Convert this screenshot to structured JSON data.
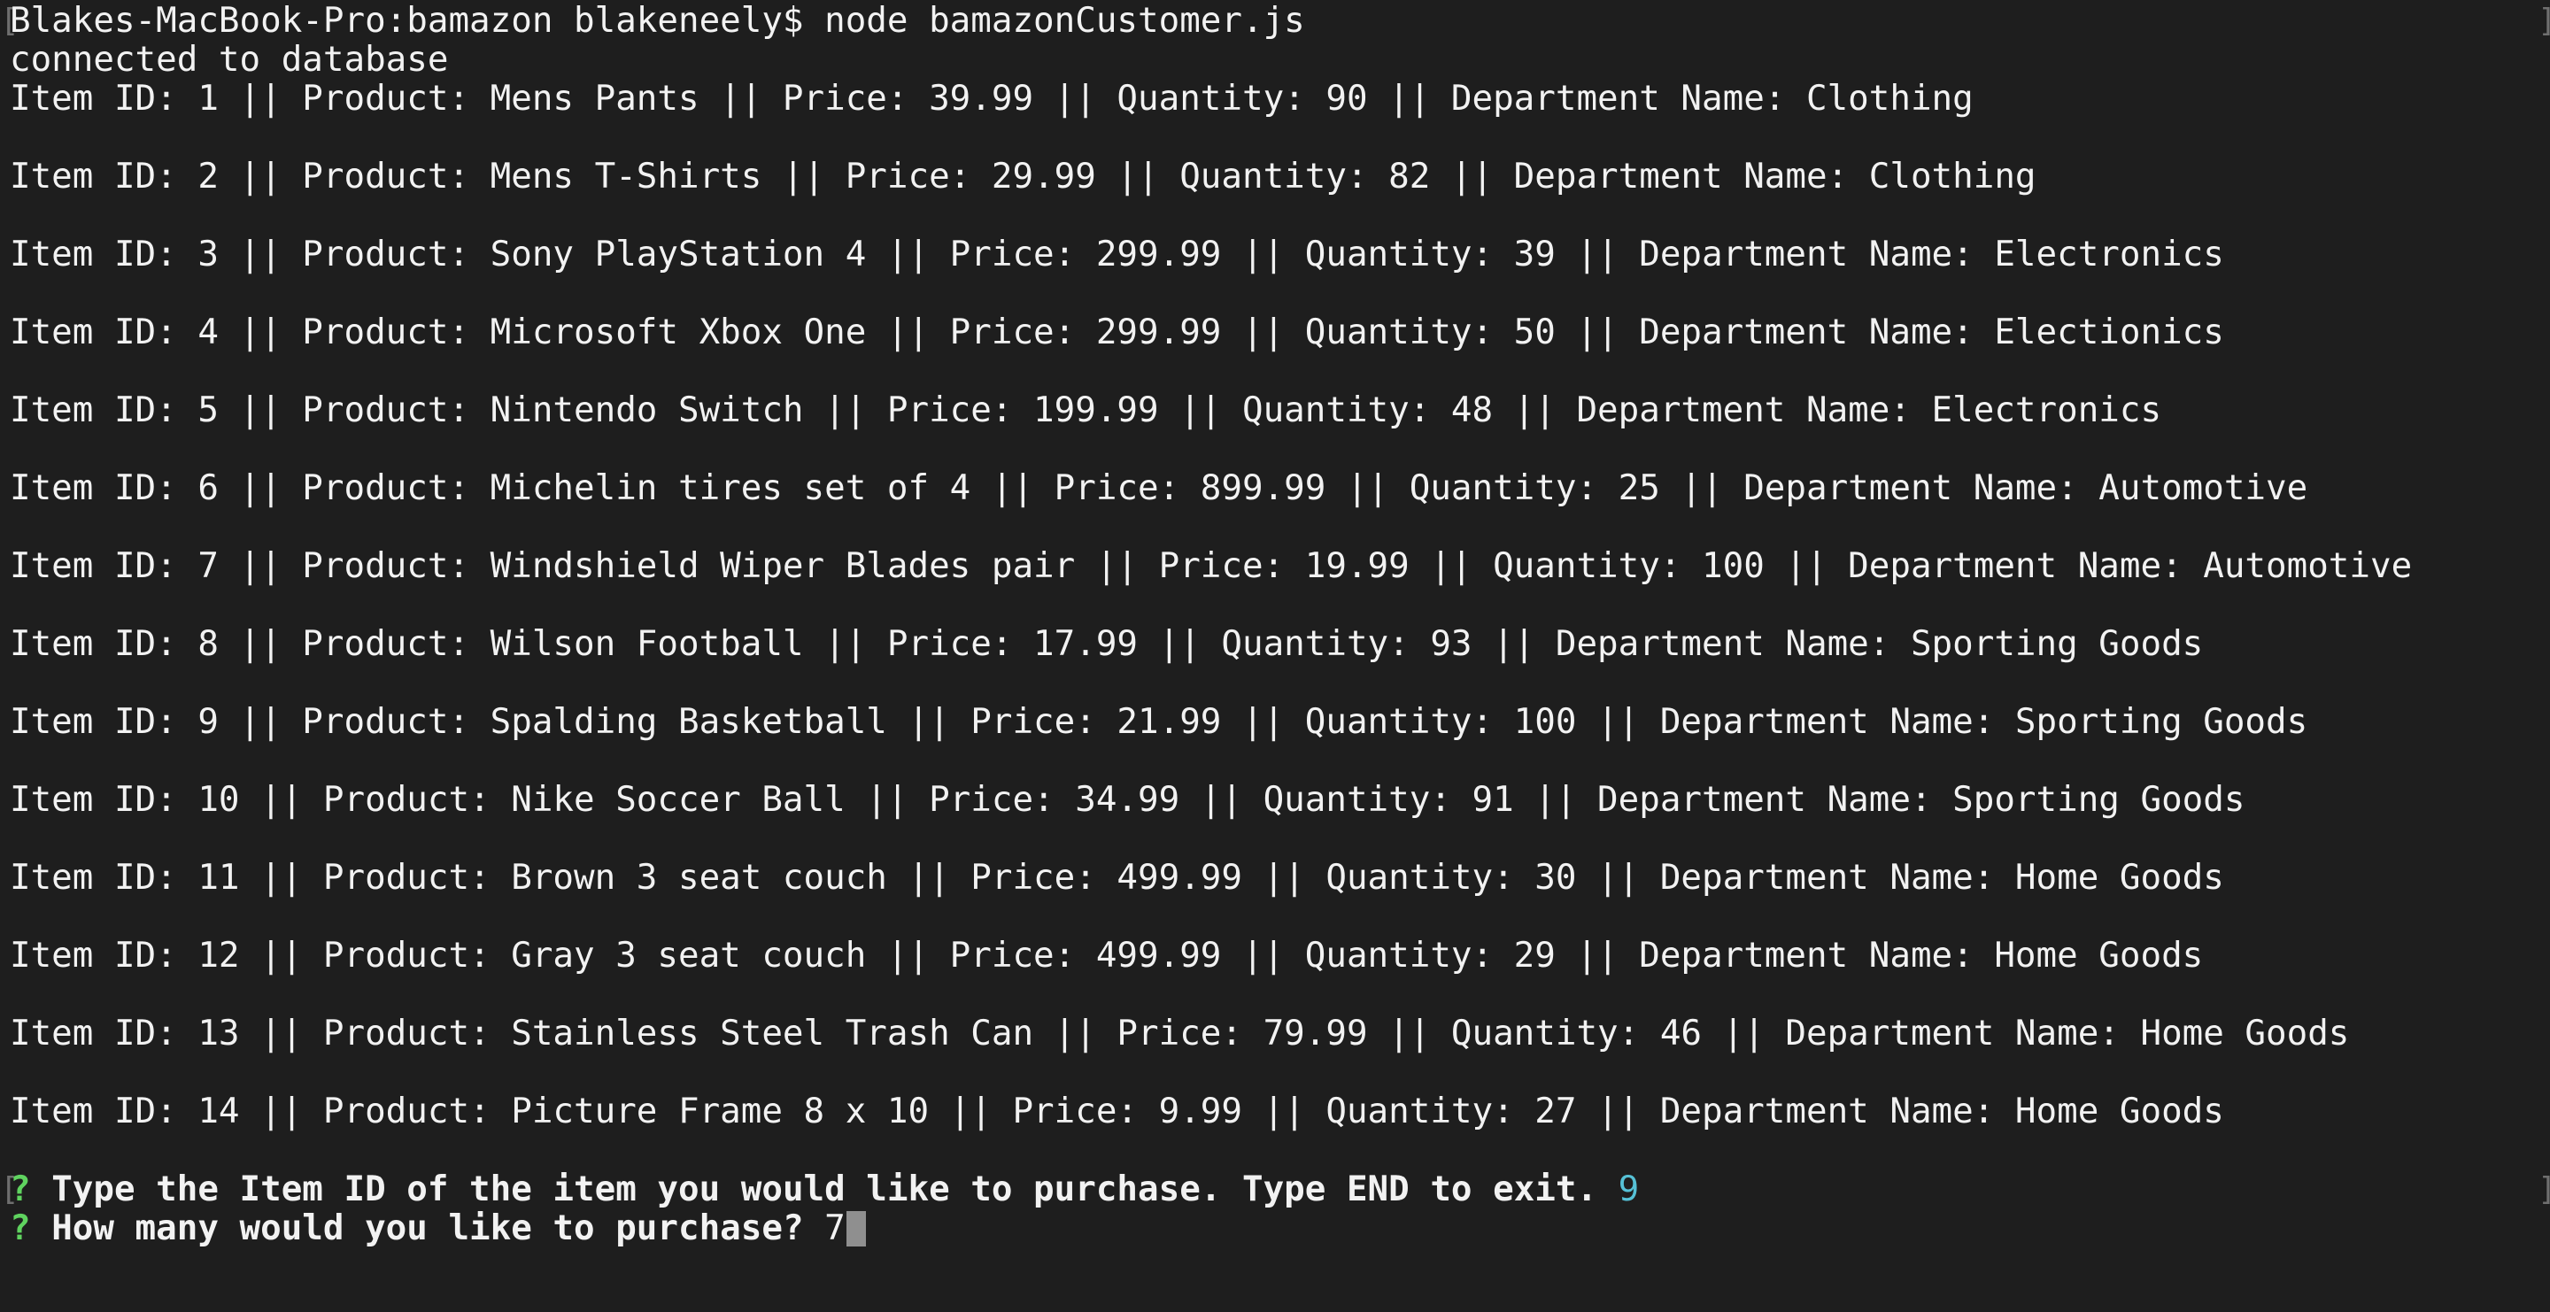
{
  "terminal": {
    "command_line": "Blakes-MacBook-Pro:bamazon blakeneely$ node bamazonCustomer.js",
    "status": "connected to database",
    "items": [
      "Item ID: 1 || Product: Mens Pants || Price: 39.99 || Quantity: 90 || Department Name: Clothing",
      "Item ID: 2 || Product: Mens T-Shirts || Price: 29.99 || Quantity: 82 || Department Name: Clothing",
      "Item ID: 3 || Product: Sony PlayStation 4 || Price: 299.99 || Quantity: 39 || Department Name: Electronics",
      "Item ID: 4 || Product: Microsoft Xbox One || Price: 299.99 || Quantity: 50 || Department Name: Electionics",
      "Item ID: 5 || Product: Nintendo Switch || Price: 199.99 || Quantity: 48 || Department Name: Electronics",
      "Item ID: 6 || Product: Michelin tires set of 4 || Price: 899.99 || Quantity: 25 || Department Name: Automotive",
      "Item ID: 7 || Product: Windshield Wiper Blades pair || Price: 19.99 || Quantity: 100 || Department Name: Automotive",
      "Item ID: 8 || Product: Wilson Football || Price: 17.99 || Quantity: 93 || Department Name: Sporting Goods",
      "Item ID: 9 || Product: Spalding Basketball || Price: 21.99 || Quantity: 100 || Department Name: Sporting Goods",
      "Item ID: 10 || Product: Nike Soccer Ball || Price: 34.99 || Quantity: 91 || Department Name: Sporting Goods",
      "Item ID: 11 || Product: Brown 3 seat couch || Price: 499.99 || Quantity: 30 || Department Name: Home Goods",
      "Item ID: 12 || Product: Gray 3 seat couch || Price: 499.99 || Quantity: 29 || Department Name: Home Goods",
      "Item ID: 13 || Product: Stainless Steel Trash Can || Price: 79.99 || Quantity: 46 || Department Name: Home Goods",
      "Item ID: 14 || Product: Picture Frame 8 x 10 || Price: 9.99 || Quantity: 27 || Department Name: Home Goods"
    ],
    "prompt1": {
      "marker": "?",
      "question": "Type the Item ID of the item you would like to purchase. Type END to exit.",
      "answer": "9"
    },
    "prompt2": {
      "marker": "?",
      "question": "How many would you like to purchase?",
      "answer": "7"
    }
  },
  "colors": {
    "background": "#1e1e1e",
    "text": "#f2f2f2",
    "prompt_marker": "#5fd35f",
    "answer_highlight": "#56c1d6"
  }
}
